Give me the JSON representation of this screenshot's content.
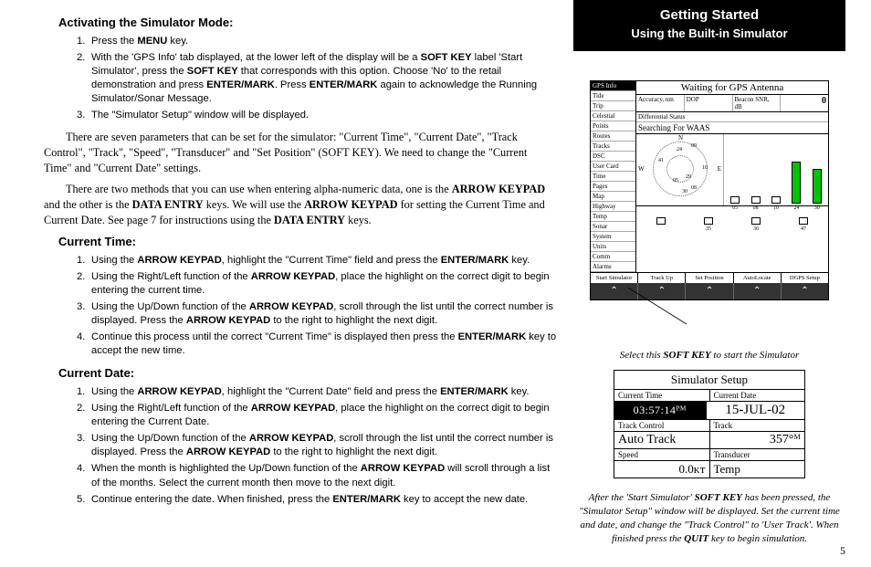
{
  "left": {
    "h1": "Activating the Simulator Mode:",
    "list1": [
      {
        "n": "1.",
        "t": "Press the <b>MENU</b> key."
      },
      {
        "n": "2.",
        "t": "With the 'GPS Info' tab displayed, at the lower left of the display will be a <b>SOFT KEY</b> label 'Start Simulator', press the <b>SOFT KEY</b> that corresponds with this option. Choose 'No' to the retail demonstration and press <b>ENTER/MARK</b>. Press <b>ENTER/MARK</b> again to acknowledge the Running Simulator/Sonar Message."
      },
      {
        "n": "3.",
        "t": "The \"Simulator Setup\" window will be displayed."
      }
    ],
    "para1": "There are seven parameters that can be set for the simulator: \"Current Time\", \"Current Date\", \"Track Control\", \"Track\", \"Speed\", \"Transducer\" and \"Set Position\" (SOFT KEY). We need to change the \"Current Time\" and \"Current Date\" settings.",
    "para2": "There are two methods that you can use when entering alpha-numeric data, one is the <b>ARROW KEYPAD</b> and the other is the <b>DATA ENTRY</b> keys. We will use the <b>ARROW KEYPAD</b> for setting the Current Time and Current Date. See page 7 for instructions using the <b>DATA ENTRY</b> keys.",
    "h2": "Current Time:",
    "list2": [
      {
        "n": "1.",
        "t": "Using the <b>ARROW KEYPAD</b>, highlight the \"Current Time\" field and press the <b>ENTER/MARK</b> key."
      },
      {
        "n": "2.",
        "t": "Using the Right/Left function of the <b>ARROW KEYPAD</b>, place the highlight on the correct digit to begin entering the current time."
      },
      {
        "n": "3.",
        "t": "Using the Up/Down function of the <b>ARROW KEYPAD</b>, scroll through the list until the correct number is displayed. Press the <b>ARROW KEYPAD</b> to the right to highlight the next digit."
      },
      {
        "n": "4.",
        "t": "Continue this process until the correct \"Current Time\" is displayed then press the <b>ENTER/MARK</b> key to accept the new time."
      }
    ],
    "h3": "Current Date:",
    "list3": [
      {
        "n": "1.",
        "t": "Using the <b>ARROW KEYPAD</b>, highlight the \"Current Date\" field and press the <b>ENTER/MARK</b> key."
      },
      {
        "n": "2.",
        "t": "Using the Right/Left function of the <b>ARROW KEYPAD</b>, place the highlight on the correct digit to begin entering the Current Date."
      },
      {
        "n": "3.",
        "t": "Using the Up/Down function of the <b>ARROW KEYPAD</b>, scroll through the list until the correct number is displayed. Press the <b>ARROW KEYPAD</b> to the right to highlight the next digit."
      },
      {
        "n": "4.",
        "t": "When the month is highlighted the Up/Down function of the <b>ARROW KEYPAD</b> will scroll through a list of the months. Select the current month then move to the next digit."
      },
      {
        "n": "5.",
        "t": "Continue entering the date. When finished, press the <b>ENTER/MARK</b> key to accept the new date."
      }
    ]
  },
  "right": {
    "hdr": {
      "t1": "Getting Started",
      "t2": "Using the Built-in Simulator"
    },
    "shot1": {
      "title": "Waiting for GPS Antenna",
      "tabs": [
        "GPS Info",
        "Tide",
        "Trip",
        "Celestial",
        "Points",
        "Routes",
        "Tracks",
        "DSC",
        "User Card",
        "Time",
        "Pages",
        "Map",
        "Highway",
        "Temp",
        "Sonar",
        "System",
        "Units",
        "Comm",
        "Alarms"
      ],
      "selected_tab": "GPS Info",
      "meta": {
        "acc": "Accuracy, nm",
        "dop": "DOP",
        "snr": "Beacon SNR, dB",
        "snr_val": "0"
      },
      "diff": "Differential Status",
      "waas": "Searching For WAAS",
      "sky": {
        "sats": [
          "09",
          "24",
          "10",
          "05",
          "29",
          "30",
          "08"
        ]
      },
      "bars": [
        {
          "h": 8,
          "f": false,
          "l": "05"
        },
        {
          "h": 8,
          "f": false,
          "l": "08"
        },
        {
          "h": 8,
          "f": false,
          "l": "10"
        },
        {
          "h": 46,
          "f": true,
          "l": "24"
        },
        {
          "h": 38,
          "f": true,
          "l": "30"
        },
        {
          "h": 8,
          "f": false,
          "l": ""
        },
        {
          "h": 8,
          "f": false,
          "l": "35"
        },
        {
          "h": 8,
          "f": false,
          "l": "36"
        },
        {
          "h": 8,
          "f": false,
          "l": "47"
        }
      ],
      "softkeys": [
        "Start Simulator",
        "Track Up",
        "Set Position",
        "AutoLocate",
        "DGPS Setup"
      ]
    },
    "caption1_pre": "Select this ",
    "caption1_b": "SOFT KEY",
    "caption1_post": " to start the Simulator",
    "shot2": {
      "title": "Simulator Setup",
      "r1": {
        "l": "Current Time",
        "r": "Current Date"
      },
      "r2": {
        "l": "03:57:14ᴾᴹ",
        "r": "15-JUL-02"
      },
      "r3": {
        "l": "Track Control",
        "r": "Track"
      },
      "r4": {
        "l": "Auto Track",
        "r": "357°ᴹ"
      },
      "r5": {
        "l": "Speed",
        "r": "Transducer"
      },
      "r6": {
        "l": "0.0ᴋᴛ",
        "r": "Temp"
      }
    },
    "caption2": "After the 'Start Simulator' <b>SOFT KEY</b> has been pressed, the \"Simulator Setup\" window will be displayed. Set the current time and date, and change the \"Track Control\" to 'User Track'. When finished press the <b>QUIT</b> key to begin simulation.",
    "pagenum": "5"
  }
}
